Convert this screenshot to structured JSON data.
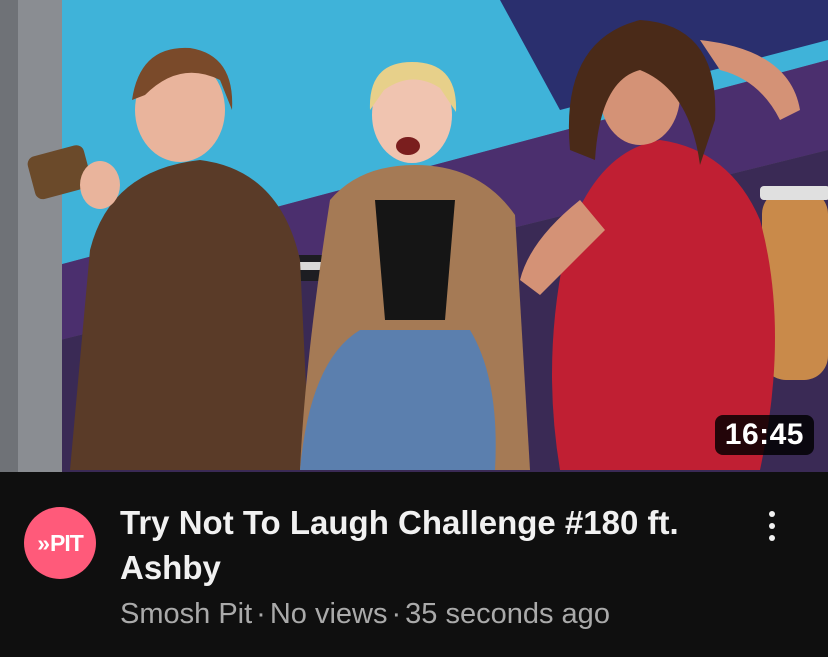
{
  "video": {
    "duration": "16:45",
    "title": "Try Not To Laugh Challenge #180 ft. Ashby",
    "channel": "Smosh Pit",
    "views": "No views",
    "age": "35 seconds ago",
    "separator": "·"
  },
  "avatar": {
    "text": "PIT",
    "icon": "double-chevron-icon"
  },
  "menu": {
    "icon": "more-vert-icon"
  },
  "colors": {
    "background": "#0f0f0f",
    "avatar_bg": "#ff5a7a",
    "title_text": "#f1f1f1",
    "meta_text": "#aaaaaa",
    "badge_bg": "#000000"
  }
}
